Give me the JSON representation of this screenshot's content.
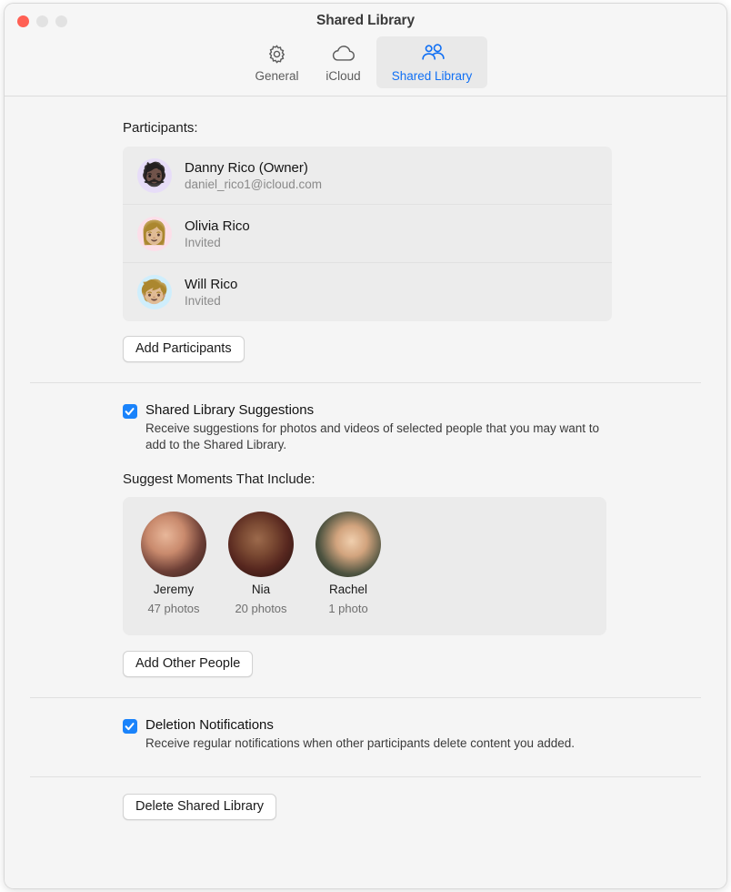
{
  "window": {
    "title": "Shared Library",
    "traffic_lights": [
      "close-button",
      "minimize-button",
      "zoom-button"
    ]
  },
  "toolbar": {
    "tabs": [
      {
        "label": "General",
        "icon": "gear-icon",
        "selected": false
      },
      {
        "label": "iCloud",
        "icon": "cloud-icon",
        "selected": false
      },
      {
        "label": "Shared Library",
        "icon": "people-icon",
        "selected": true
      }
    ]
  },
  "participants_section": {
    "label": "Participants:",
    "items": [
      {
        "name": "Danny Rico (Owner)",
        "detail": "daniel_rico1@icloud.com",
        "avatar": "memoji-man-beard",
        "avatar_bg": "#e7ddf8",
        "glyph": "🧔🏿"
      },
      {
        "name": "Olivia Rico",
        "detail": "Invited",
        "avatar": "memoji-woman-pink-hair",
        "avatar_bg": "#fcdfe9",
        "glyph": "👩🏼"
      },
      {
        "name": "Will Rico",
        "detail": "Invited",
        "avatar": "memoji-boy-cap",
        "avatar_bg": "#cfeefc",
        "glyph": "🧒🏼"
      }
    ],
    "add_button": "Add Participants"
  },
  "suggestions_section": {
    "checkbox_label": "Shared Library Suggestions",
    "checkbox_checked": true,
    "description": "Receive suggestions for photos and videos of selected people that you may want to add to the Shared Library.",
    "sub_label": "Suggest Moments That Include:",
    "people": [
      {
        "name": "Jeremy",
        "count": "47 photos"
      },
      {
        "name": "Nia",
        "count": "20 photos"
      },
      {
        "name": "Rachel",
        "count": "1 photo"
      }
    ],
    "add_button": "Add Other People"
  },
  "deletion_section": {
    "checkbox_label": "Deletion Notifications",
    "checkbox_checked": true,
    "description": "Receive regular notifications when other participants delete content you added."
  },
  "footer": {
    "delete_button": "Delete Shared Library"
  },
  "colors": {
    "accent": "#1170f4",
    "checkbox": "#1a83fb",
    "close": "#ff6054",
    "page_bg": "#f5f5f5",
    "card_bg": "#ebebeb",
    "list_bg": "#ececec"
  }
}
